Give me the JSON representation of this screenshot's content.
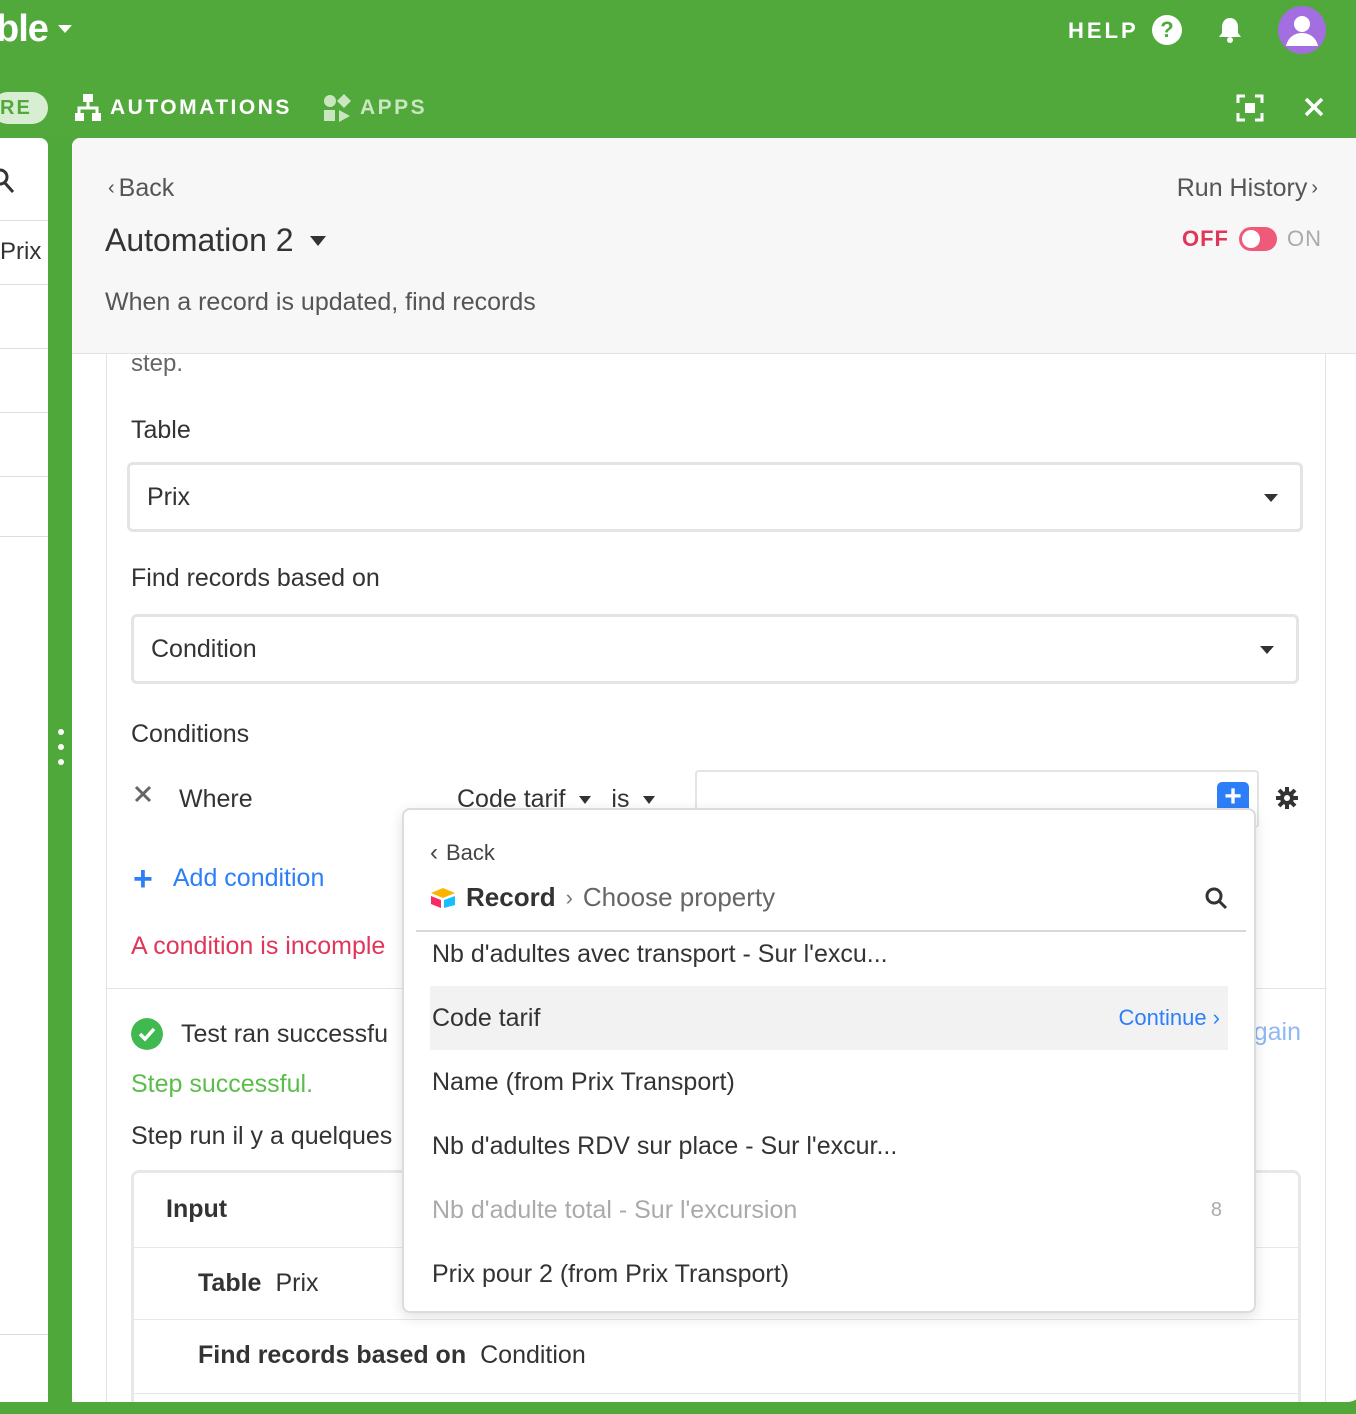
{
  "topbar": {
    "app_name": "ble",
    "help_label": "HELP",
    "help_icon": "question-circle-icon",
    "notifications_icon": "bell-icon",
    "avatar_icon": "user-avatar-icon"
  },
  "nav": {
    "pill_label": "RE",
    "automations_label": "AUTOMATIONS",
    "apps_label": "APPS",
    "expand_icon": "expand-icon",
    "close_icon": "close-icon"
  },
  "left_panel": {
    "prix_label": "Prix"
  },
  "header": {
    "back_label": "Back",
    "run_history_label": "Run History",
    "automation_title": "Automation 2",
    "toggle_off": "OFF",
    "toggle_on": "ON",
    "subtitle": "When a record is updated, find records"
  },
  "form": {
    "step_text": "step.",
    "table_label": "Table",
    "table_value": "Prix",
    "find_label": "Find records based on",
    "find_value": "Condition",
    "conditions_label": "Conditions",
    "where_label": "Where",
    "condition_field": "Code tarif",
    "condition_operator": "is",
    "add_condition_label": "Add condition",
    "incomplete_msg": "A condition is incomple",
    "test_ok_label": "Test ran successfu",
    "step_success": "Step successful.",
    "step_run": "Step run il y a quelques",
    "again_label": "gain",
    "input_heading": "Input",
    "input_rows": [
      {
        "key": "Table",
        "value": "Prix"
      },
      {
        "key": "Find records based on",
        "value": "Condition"
      }
    ]
  },
  "popover": {
    "back_label": "Back",
    "record_label": "Record",
    "separator": "›",
    "choose_label": "Choose property",
    "items": [
      {
        "label": "Nb d'adultes avec transport - Sur l'excu...",
        "right": "",
        "disabled": false
      },
      {
        "label": "Code tarif",
        "right": "Continue ›",
        "disabled": false
      },
      {
        "label": "Name (from Prix Transport)",
        "right": "",
        "disabled": false
      },
      {
        "label": "Nb d'adultes RDV sur place - Sur l'excur...",
        "right": "",
        "disabled": false
      },
      {
        "label": "Nb d'adulte total - Sur l'excursion",
        "right": "8",
        "disabled": true
      },
      {
        "label": "Prix pour 2 (from Prix Transport)",
        "right": "",
        "disabled": false
      }
    ]
  },
  "colors": {
    "brand_green": "#51a93c",
    "link_blue": "#2d7ff9",
    "error_red": "#e0365a",
    "success_green": "#5bbd4a"
  }
}
